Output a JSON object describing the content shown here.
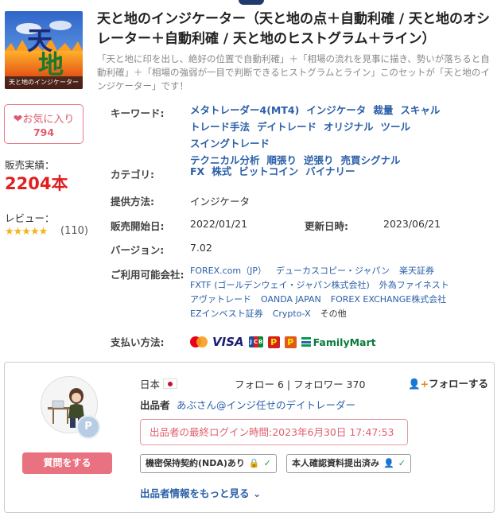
{
  "product": {
    "title": "天と地のインジケーター（天と地の点＋自動利確 / 天と地のオシレーター＋自動利確 / 天と地のヒストグラム＋ライン）",
    "subtitle": "「天と地に印を出し、絶好の位置で自動利確」＋「相場の流れを見事に描き、勢いが落ちると自動利確」＋「相場の強弱が一目で判断できるヒストグラムとライン」このセットが「天と地のインジケーター」です！",
    "thumbnail": {
      "logo_char_1": "天",
      "logo_char_2": "地",
      "caption": "天と地のインジケーター"
    }
  },
  "favorite": {
    "label": "お気に入り",
    "count": "794",
    "icon": "heart-icon"
  },
  "sales": {
    "label": "販売実績：",
    "value": "2204本"
  },
  "review": {
    "label": "レビュー：",
    "stars": "★★★★★",
    "rating": 5,
    "count": "(110)"
  },
  "info": {
    "keywords_label": "キーワード:",
    "keywords": [
      "メタトレーダー4(MT4)",
      "インジケータ",
      "裁量",
      "スキャル",
      "トレード手法",
      "デイトレード",
      "オリジナル",
      "ツール",
      "スイングトレード",
      "テクニカル分析",
      "順張り",
      "逆張り",
      "売買シグナル"
    ],
    "category_label": "カテゴリ:",
    "categories": [
      "FX",
      "株式",
      "ビットコイン",
      "バイナリー"
    ],
    "method_label": "提供方法:",
    "method": "インジケータ",
    "start_label": "販売開始日:",
    "start": "2022/01/21",
    "update_label": "更新日時:",
    "update": "2023/06/21",
    "version_label": "バージョン:",
    "version": "7.02",
    "companies_label": "ご利用可能会社:",
    "companies": [
      "FOREX.com（JP）",
      "デューカスコピー・ジャパン",
      "楽天証券",
      "FXTF (ゴールデンウェイ・ジャパン株式会社)",
      "外為ファイネスト",
      "アヴァトレード",
      "OANDA JAPAN",
      "FOREX EXCHANGE株式会社",
      "EZインベスト証券",
      "Crypto-X"
    ],
    "companies_other": "その他",
    "payment_label": "支払い方法:",
    "payment": {
      "visa": "VISA",
      "jcb": [
        "J",
        "C",
        "B"
      ],
      "p1": "P",
      "p2": "P",
      "familymart": "FamilyMart"
    }
  },
  "seller": {
    "country": "日本",
    "follow_text": "フォロー 6 | フォロワー 370",
    "follow_button": "フォローする",
    "seller_label": "出品者",
    "seller_name": "あぶさん@インジ任せのデイトレーダー",
    "last_login": "出品者の最終ログイン時間:2023年6月30日 17:47:53",
    "nda": "機密保持契約(NDA)あり",
    "identity": "本人確認資料提出済み",
    "ask_button": "質問をする",
    "badge": "P",
    "more": "出品者情報をもっと見る"
  },
  "colors": {
    "accent_link": "#2b5fa8",
    "sales_red": "#e02020",
    "pink": "#e8727f",
    "star": "#f3b41b"
  }
}
